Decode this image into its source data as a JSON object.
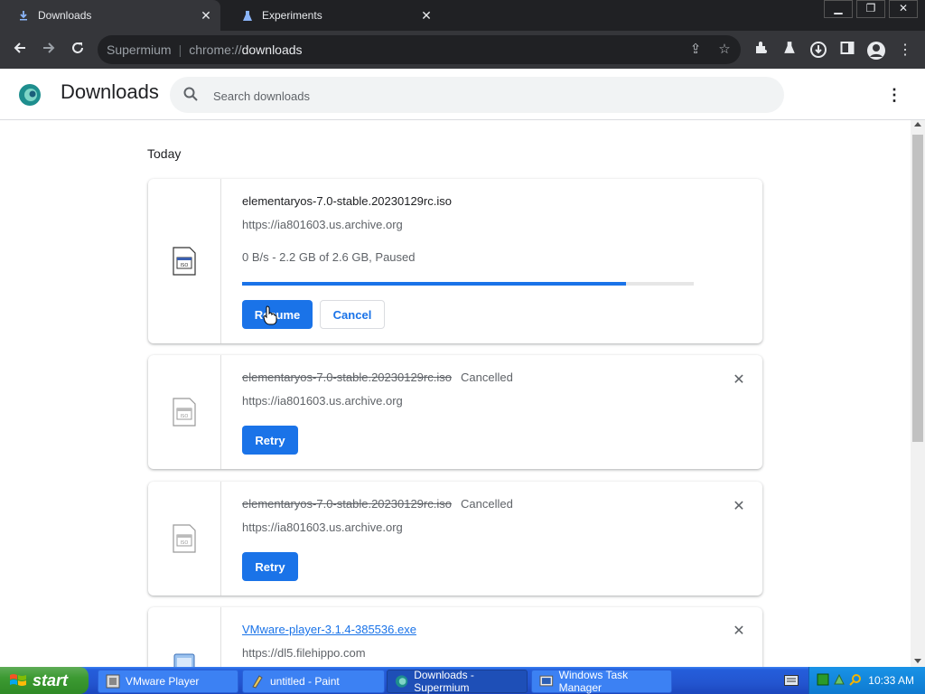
{
  "tabs": [
    {
      "title": "Downloads",
      "icon": "download-icon"
    },
    {
      "title": "Experiments",
      "icon": "flask-icon"
    }
  ],
  "window_controls": {
    "minimize": "▁",
    "restore": "❐",
    "close": "✕"
  },
  "omnibox": {
    "brand": "Supermium",
    "separator": "|",
    "url_prefix": "chrome://",
    "url_host": "downloads"
  },
  "page": {
    "title": "Downloads",
    "search_placeholder": "Search downloads",
    "section_label": "Today"
  },
  "downloads": [
    {
      "filename": "elementaryos-7.0-stable.20230129rc.iso",
      "url": "https://ia801603.us.archive.org",
      "progress_text": "0 B/s - 2.2 GB of 2.6 GB, Paused",
      "progress_fraction": 0.85,
      "state": "paused",
      "primary_label": "Resume",
      "secondary_label": "Cancel"
    },
    {
      "filename": "elementaryos-7.0-stable.20230129rc.iso",
      "status": "Cancelled",
      "url": "https://ia801603.us.archive.org",
      "state": "cancelled",
      "primary_label": "Retry"
    },
    {
      "filename": "elementaryos-7.0-stable.20230129rc.iso",
      "status": "Cancelled",
      "url": "https://ia801603.us.archive.org",
      "state": "cancelled",
      "primary_label": "Retry"
    },
    {
      "filename": "VMware-player-3.1.4-385536.exe",
      "url": "https://dl5.filehippo.com",
      "state": "complete"
    }
  ],
  "taskbar": {
    "start_label": "start",
    "tasks": [
      {
        "label": "VMware Player",
        "icon": "vmware-icon"
      },
      {
        "label": "untitled - Paint",
        "icon": "paint-icon"
      },
      {
        "label": "Downloads - Supermium",
        "icon": "supermium-icon"
      },
      {
        "label": "Windows Task Manager",
        "icon": "task-manager-icon"
      }
    ],
    "clock": "10:33 AM"
  }
}
